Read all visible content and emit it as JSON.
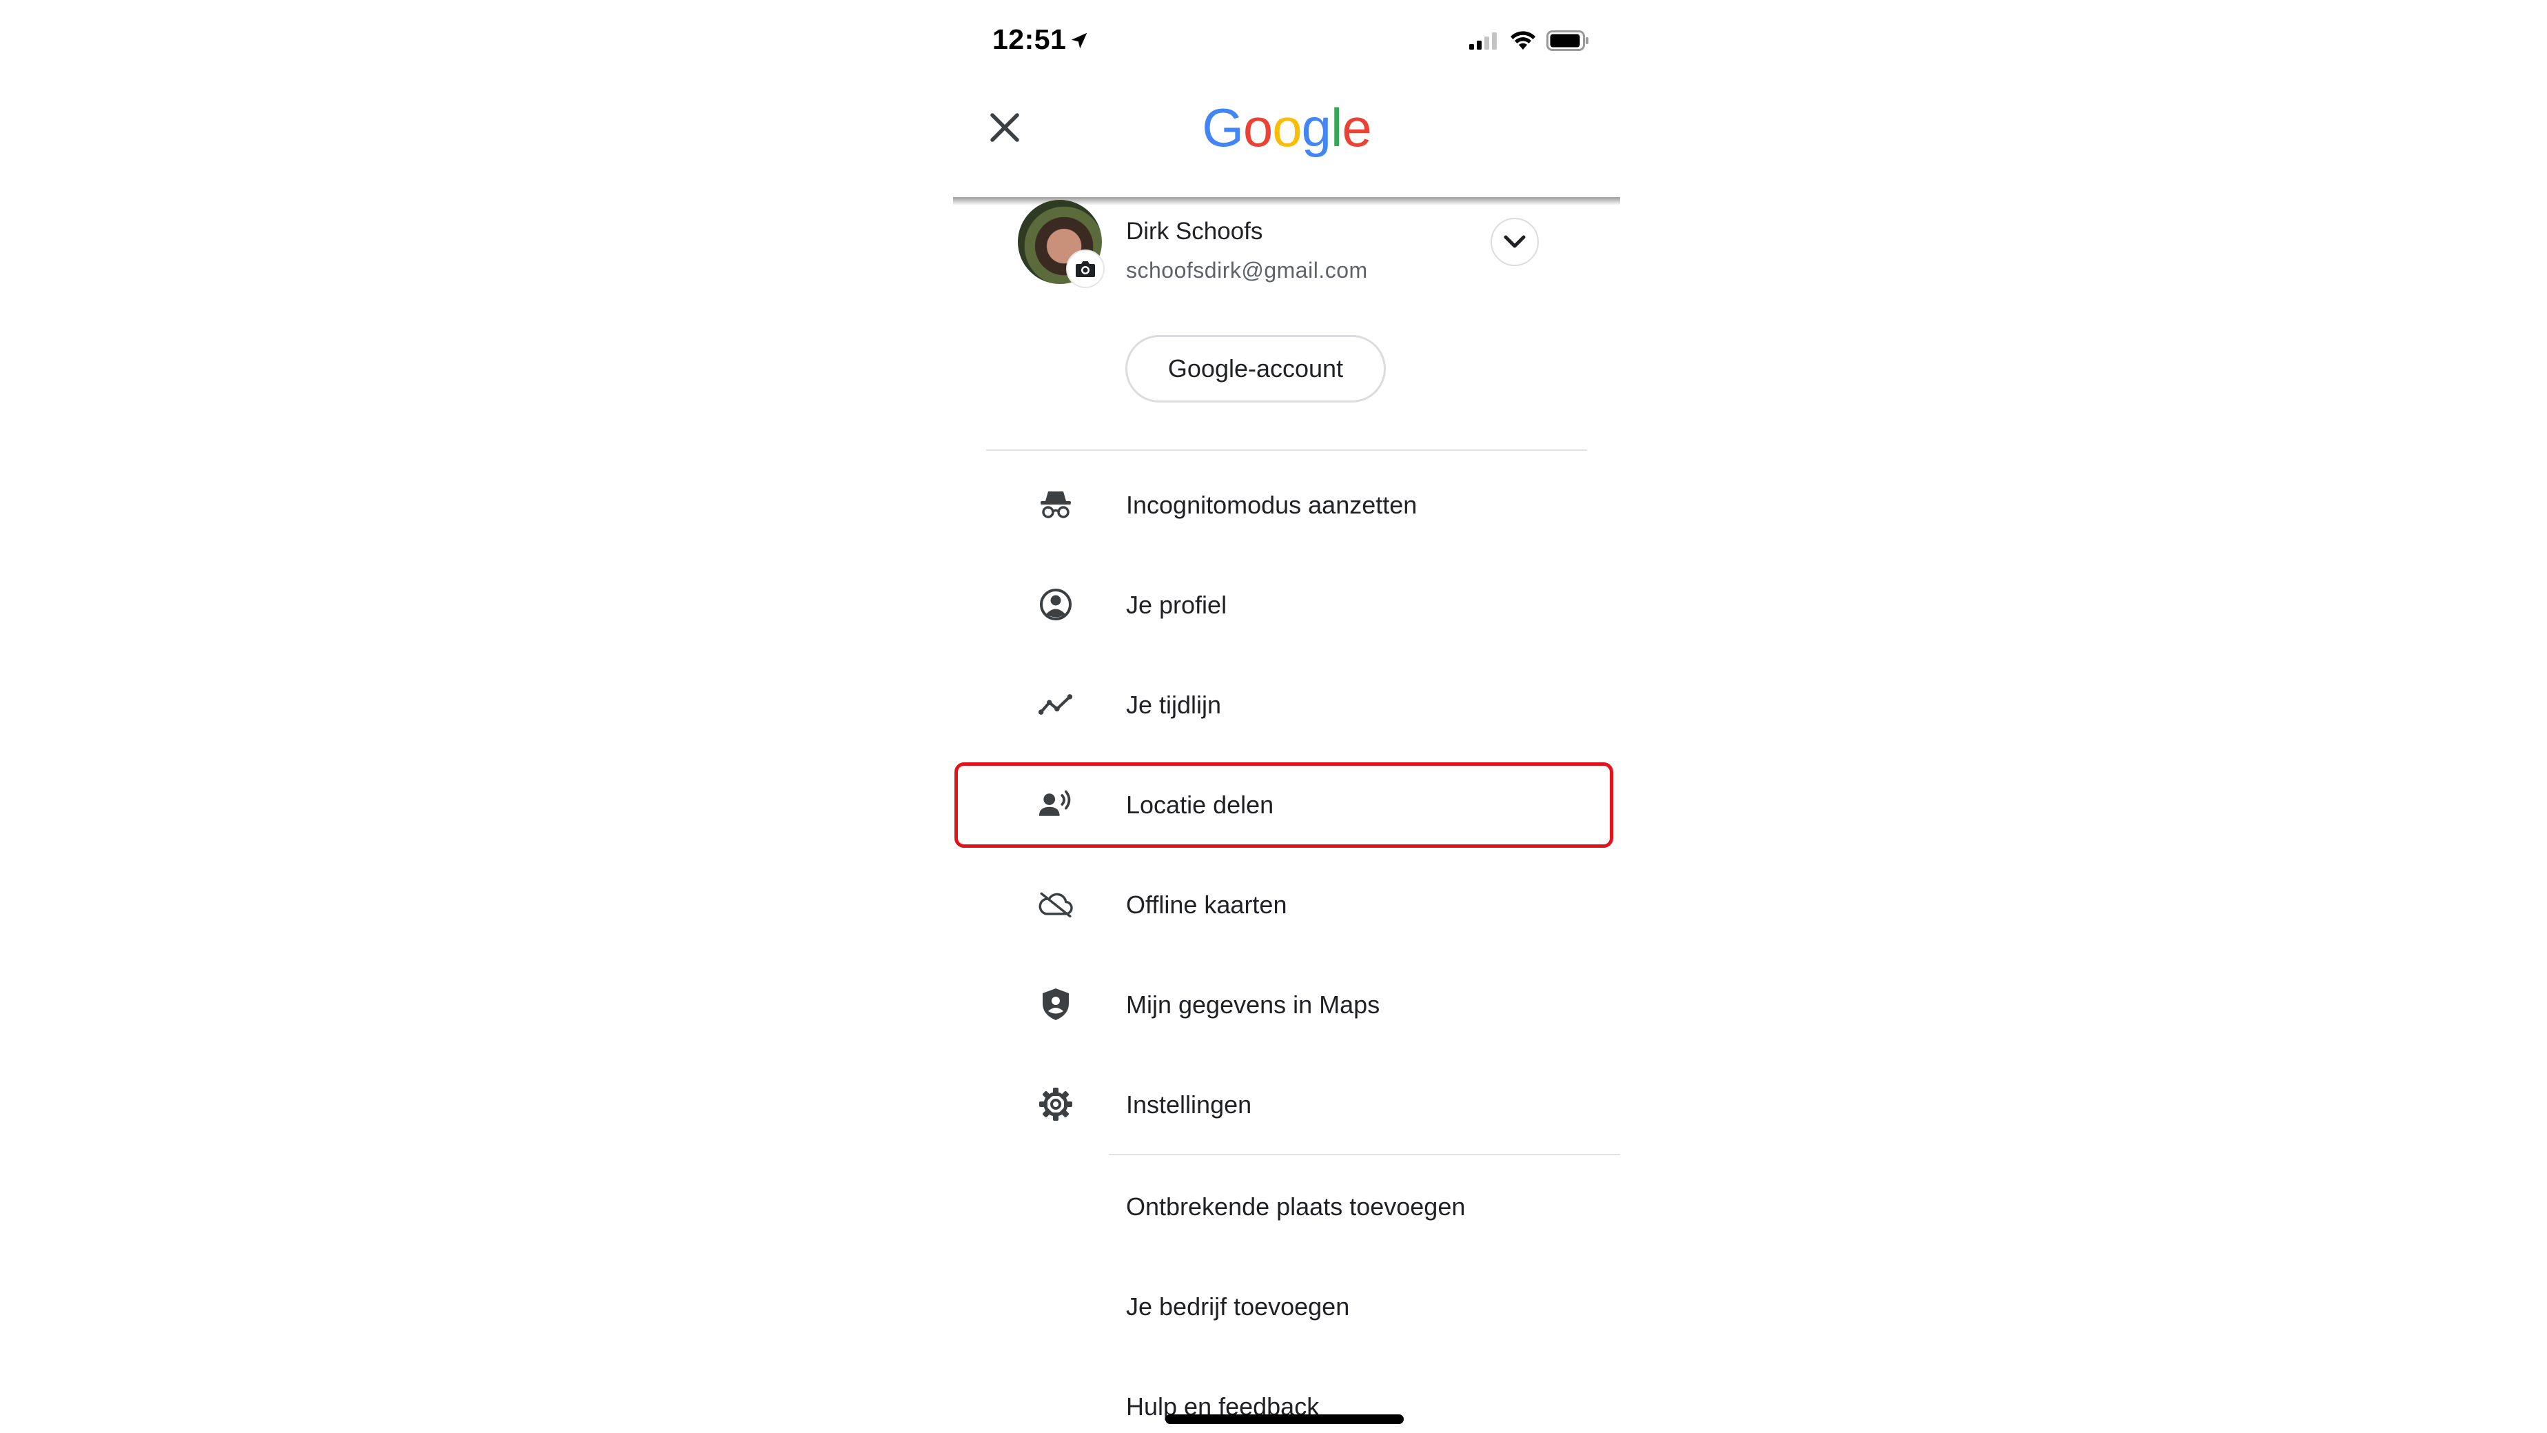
{
  "status_bar": {
    "time": "12:51"
  },
  "header": {
    "logo_letters": [
      {
        "ch": "G",
        "color": "#4285F4"
      },
      {
        "ch": "o",
        "color": "#EA4335"
      },
      {
        "ch": "o",
        "color": "#FBBC05"
      },
      {
        "ch": "g",
        "color": "#4285F4"
      },
      {
        "ch": "l",
        "color": "#34A853"
      },
      {
        "ch": "e",
        "color": "#EA4335"
      }
    ]
  },
  "account": {
    "name": "Dirk Schoofs",
    "email": "schoofsdirk@gmail.com",
    "manage_button": "Google-account"
  },
  "menu": {
    "items": [
      {
        "label": "Incognitomodus aanzetten",
        "icon": "incognito-icon"
      },
      {
        "label": "Je profiel",
        "icon": "profile-icon"
      },
      {
        "label": "Je tijdlijn",
        "icon": "timeline-icon"
      },
      {
        "label": "Locatie delen",
        "icon": "location-sharing-icon",
        "highlighted": true
      },
      {
        "label": "Offline kaarten",
        "icon": "offline-cloud-icon"
      },
      {
        "label": "Mijn gegevens in Maps",
        "icon": "data-shield-icon"
      },
      {
        "label": "Instellingen",
        "icon": "settings-gear-icon"
      }
    ],
    "secondary_items": [
      {
        "label": "Ontbrekende plaats toevoegen"
      },
      {
        "label": "Je bedrijf toevoegen"
      },
      {
        "label": "Hulp en feedback"
      }
    ]
  },
  "colors": {
    "highlight": "#e3121b",
    "text": "#202124",
    "muted": "#5f6368"
  }
}
